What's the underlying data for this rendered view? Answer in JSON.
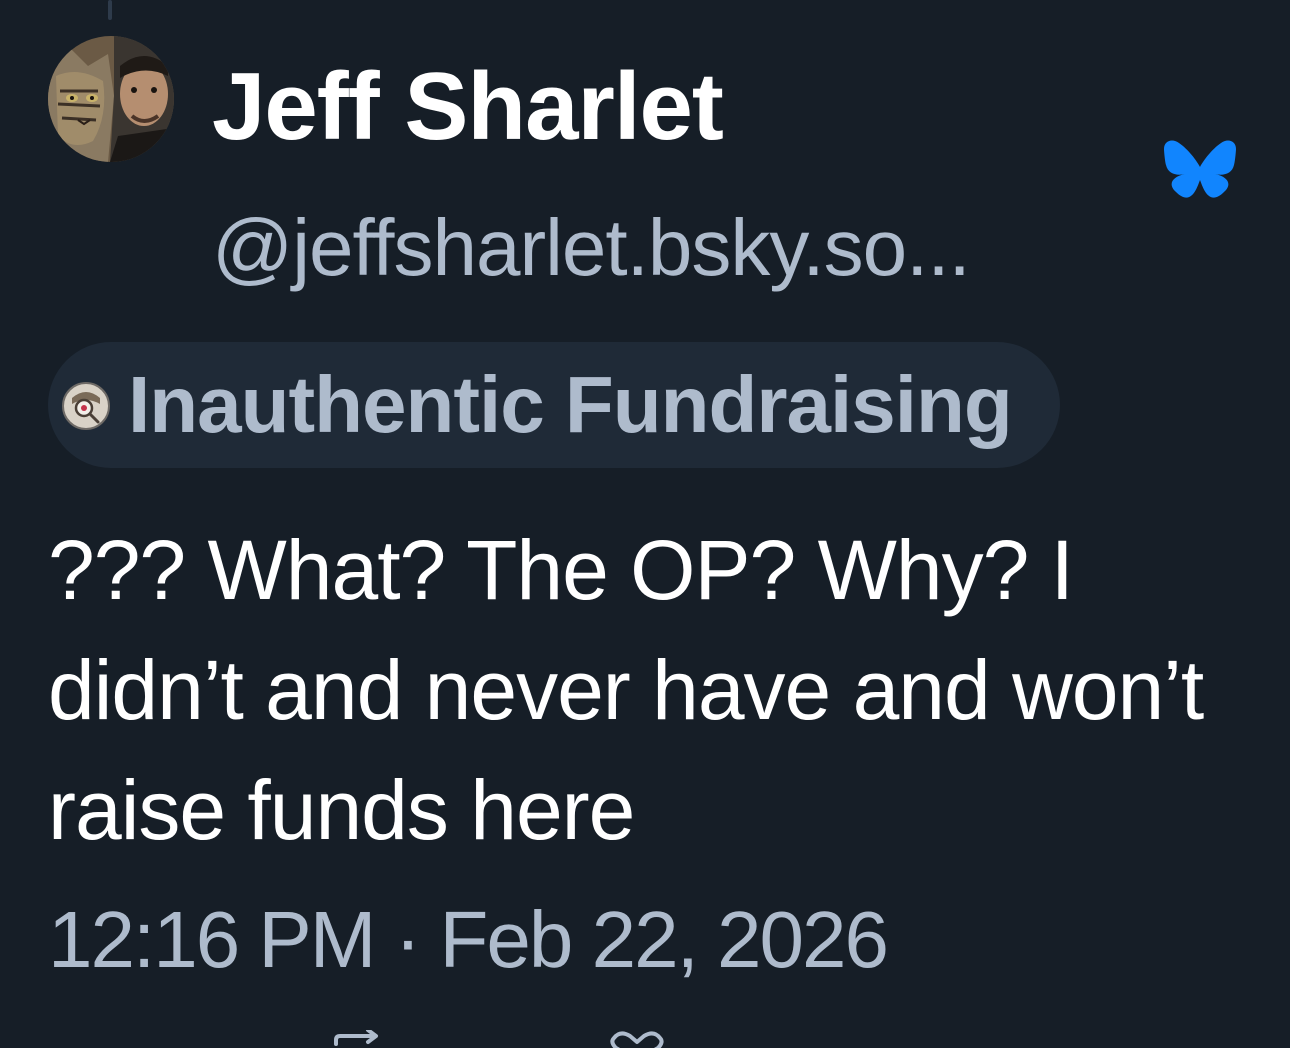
{
  "post": {
    "author": {
      "display_name": "Jeff Sharlet",
      "handle": "@jeffsharlet.bsky.so...",
      "avatar": "avatar-cat-and-man"
    },
    "platform_icon": "butterfly-icon",
    "label": {
      "icon": "magnifier-character-icon",
      "text": "Inauthentic Fundraising"
    },
    "text": "??? What? The OP? Why? I didn’t and never have and won’t raise funds here",
    "timestamp": "12:16 PM · Feb 22, 2026",
    "actions": [
      {
        "icon": "repost-icon"
      },
      {
        "icon": "like-icon"
      }
    ]
  },
  "colors": {
    "background": "#161e27",
    "secondary_text": "#aebbcc",
    "chip_background": "#1f2a37",
    "brand_blue": "#1185fe"
  }
}
